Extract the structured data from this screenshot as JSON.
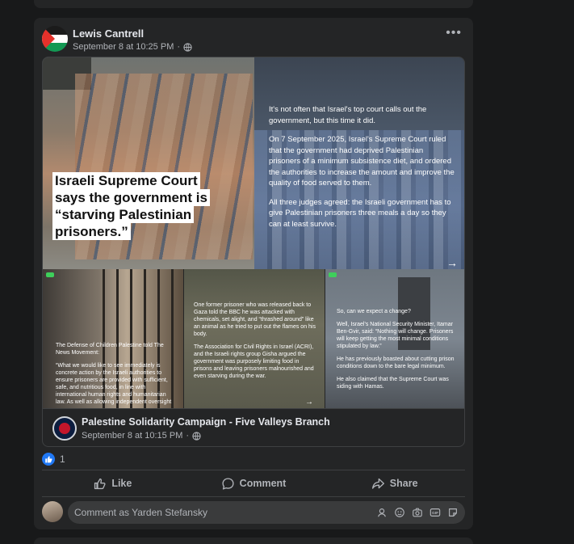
{
  "post": {
    "author": "Lewis Cantrell",
    "timestamp": "September 8 at 10:25 PM",
    "separator": "·",
    "more_label": "•••"
  },
  "shared": {
    "headline_lines": [
      "Israeli Supreme Court",
      "says the government is",
      "“starving Palestinian",
      "prisoners.”"
    ],
    "right_paragraphs": [
      "It's not often that Israel's top court calls out the government, but this time it did.",
      "On 7 September 2025, Israel's Supreme Court ruled that the government had deprived Palestinian prisoners of a minimum subsistence diet, and ordered the authorities to increase the amount and improve the quality of food served to them.",
      "All three judges agreed: the Israeli government has to give Palestinian prisoners three meals a day so they can at least survive."
    ],
    "arrow": "→",
    "thumb1_paragraphs": [
      "The Defense of Children Palestine told The News Movement:",
      "“What we would like to see immediately is concrete action by the Israeli authorities to ensure prisoners are provided with sufficient, safe, and nutritious food, in line with international human rights and humanitarian law. As well as allowing independent oversight"
    ],
    "thumb2_paragraphs": [
      "One former prisoner who was released back to Gaza told the BBC he was attacked with chemicals, set alight, and “thrashed around” like an animal as he tried to put out the flames on his body.",
      "The Association for Civil Rights in Israel (ACRI), and the Israeli rights group Gisha argued the government was purposely limiting food in prisons and leaving prisoners malnourished and even starving during the war."
    ],
    "thumb2_arrow": "→",
    "thumb3_paragraphs": [
      "So, can we expect a change?",
      "Well, Israel's National Security Minister, Itamar Ben-Gvir, said: “Nothing will change. Prisoners will keep getting the most minimal conditions stipulated by law.”",
      "He has previously boasted about cutting prison conditions down to the bare legal minimum.",
      "He also claimed that the Supreme Court was siding with Hamas."
    ],
    "source_name": "Palestine Solidarity Campaign - Five Valleys Branch",
    "source_timestamp": "September 8 at 10:15 PM"
  },
  "reactions": {
    "count": "1"
  },
  "actions": {
    "like": "Like",
    "comment": "Comment",
    "share": "Share"
  },
  "comment_box": {
    "placeholder": "Comment as Yarden Stefansky"
  },
  "colors": {
    "card": "#242526",
    "page": "#18191a",
    "like_blue": "#2078f4",
    "text": "#e4e6eb",
    "muted": "#b0b3b8"
  },
  "icons": [
    "globe-icon",
    "more-icon",
    "like-icon",
    "comment-icon",
    "share-icon",
    "avatar-icon",
    "emoji-icon",
    "camera-icon",
    "gif-icon",
    "sticker-icon"
  ]
}
